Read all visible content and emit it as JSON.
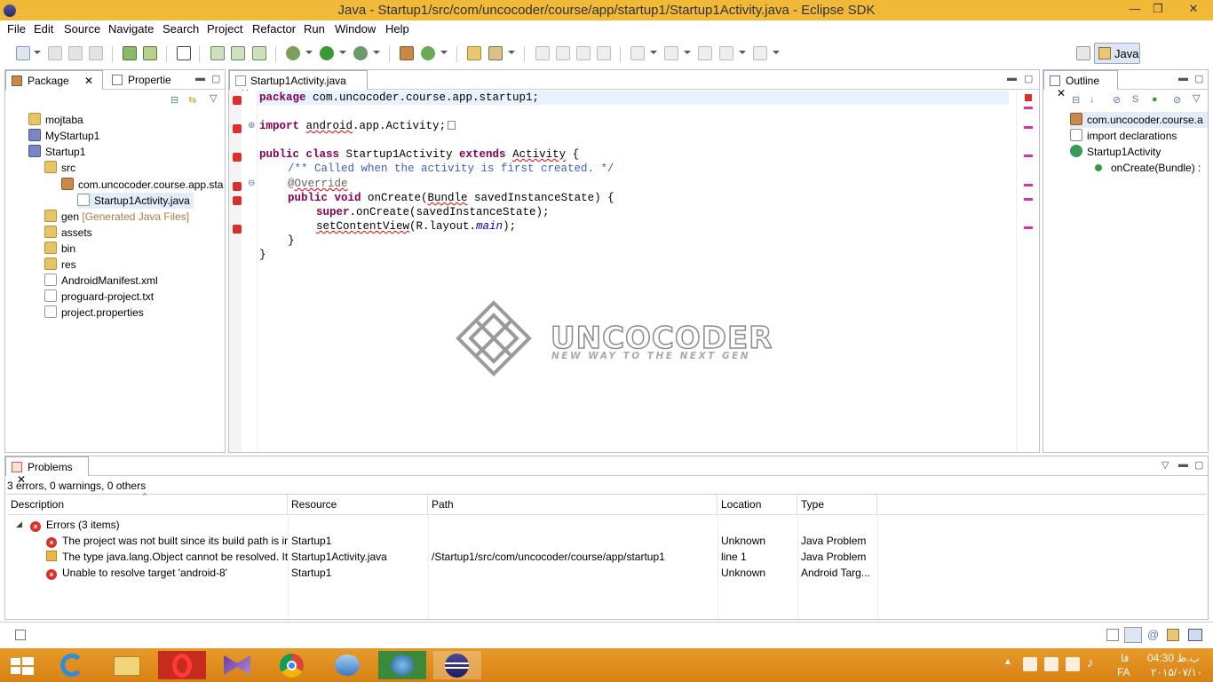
{
  "window": {
    "title": "Java - Startup1/src/com/uncocoder/course/app/startup1/Startup1Activity.java - Eclipse SDK",
    "min": "—",
    "max": "❐",
    "close": "✕"
  },
  "menu": [
    "File",
    "Edit",
    "Source",
    "Navigate",
    "Search",
    "Project",
    "Refactor",
    "Run",
    "Window",
    "Help"
  ],
  "perspective": {
    "label": "Java"
  },
  "package_explorer": {
    "tabs": [
      "Package",
      "Propertie"
    ],
    "tree": [
      {
        "label": "mojtaba",
        "suffix": ""
      },
      {
        "label": "MyStartup1",
        "suffix": ""
      },
      {
        "label": "Startup1",
        "suffix": ""
      },
      {
        "label": "src",
        "suffix": ""
      },
      {
        "label": "com.uncocoder.course.app.sta",
        "suffix": ""
      },
      {
        "label": "Startup1Activity.java",
        "suffix": ""
      },
      {
        "label": "gen",
        "suffix": "[Generated Java Files]"
      },
      {
        "label": "assets",
        "suffix": ""
      },
      {
        "label": "bin",
        "suffix": ""
      },
      {
        "label": "res",
        "suffix": ""
      },
      {
        "label": "AndroidManifest.xml",
        "suffix": ""
      },
      {
        "label": "proguard-project.txt",
        "suffix": ""
      },
      {
        "label": "project.properties",
        "suffix": ""
      }
    ]
  },
  "editor": {
    "tab": "Startup1Activity.java",
    "code": {
      "l1_kw": "package",
      "l1_rest": " com.uncocoder.course.app.startup1;",
      "l2_kw": "import",
      "l2_a": " ",
      "l2_sq": "android",
      "l2_b": ".app.Activity;",
      "l3_kw1": "public class",
      "l3_a": " Startup1Activity ",
      "l3_kw2": "extends",
      "l3_b": " ",
      "l3_sq": "Activity",
      "l3_c": " {",
      "l4": "/** Called when the activity is first created. */",
      "l5_at": "@",
      "l5_sq": "Override",
      "l6_kw": "public void",
      "l6_a": " onCreate(",
      "l6_sq": "Bundle",
      "l6_b": " savedInstanceState) {",
      "l7_kw": "super",
      "l7_a": ".onCreate(savedInstanceState);",
      "l8_sq": "setContentView",
      "l8_a": "(R.layout.",
      "l8_it": "main",
      "l8_b": ");",
      "l9": "}",
      "l10": "}"
    },
    "watermark": {
      "brand": "UNCOCODER",
      "tagline": "NEW WAY TO THE NEXT GEN"
    }
  },
  "outline": {
    "tab": "Outline",
    "items": [
      "com.uncocoder.course.a",
      "import declarations",
      "Startup1Activity",
      "onCreate(Bundle) :"
    ]
  },
  "problems": {
    "tab": "Problems",
    "summary": "3 errors, 0 warnings, 0 others",
    "columns": [
      "Description",
      "Resource",
      "Path",
      "Location",
      "Type"
    ],
    "group": "Errors (3 items)",
    "rows": [
      {
        "desc": "The project was not built since its build path is in",
        "resource": "Startup1",
        "path": "",
        "location": "Unknown",
        "type": "Java Problem"
      },
      {
        "desc": "The type java.lang.Object cannot be resolved. It",
        "resource": "Startup1Activity.java",
        "path": "/Startup1/src/com/uncocoder/course/app/startup1",
        "location": "line 1",
        "type": "Java Problem"
      },
      {
        "desc": "Unable to resolve target 'android-8'",
        "resource": "Startup1",
        "path": "",
        "location": "Unknown",
        "type": "Android Targ..."
      }
    ]
  },
  "taskbar": {
    "time": "04:30 ب.ظ",
    "date": "۲۰۱۵/۰۷/۱۰",
    "lang_fa": "فا",
    "lang_code": "FA"
  }
}
